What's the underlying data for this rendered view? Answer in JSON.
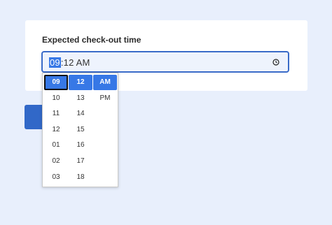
{
  "field": {
    "label": "Expected check-out time",
    "hour": "09",
    "rest": ":12 AM"
  },
  "picker": {
    "hours": [
      "09",
      "10",
      "11",
      "12",
      "01",
      "02",
      "03"
    ],
    "minutes": [
      "12",
      "13",
      "14",
      "15",
      "16",
      "17",
      "18"
    ],
    "ampm": [
      "AM",
      "PM"
    ],
    "selected": {
      "hour": "09",
      "minute": "12",
      "ampm": "AM"
    }
  },
  "colors": {
    "accent": "#3778e6",
    "background": "#e8effc",
    "button": "#3168c8"
  },
  "icons": {
    "time": "clock-icon"
  }
}
